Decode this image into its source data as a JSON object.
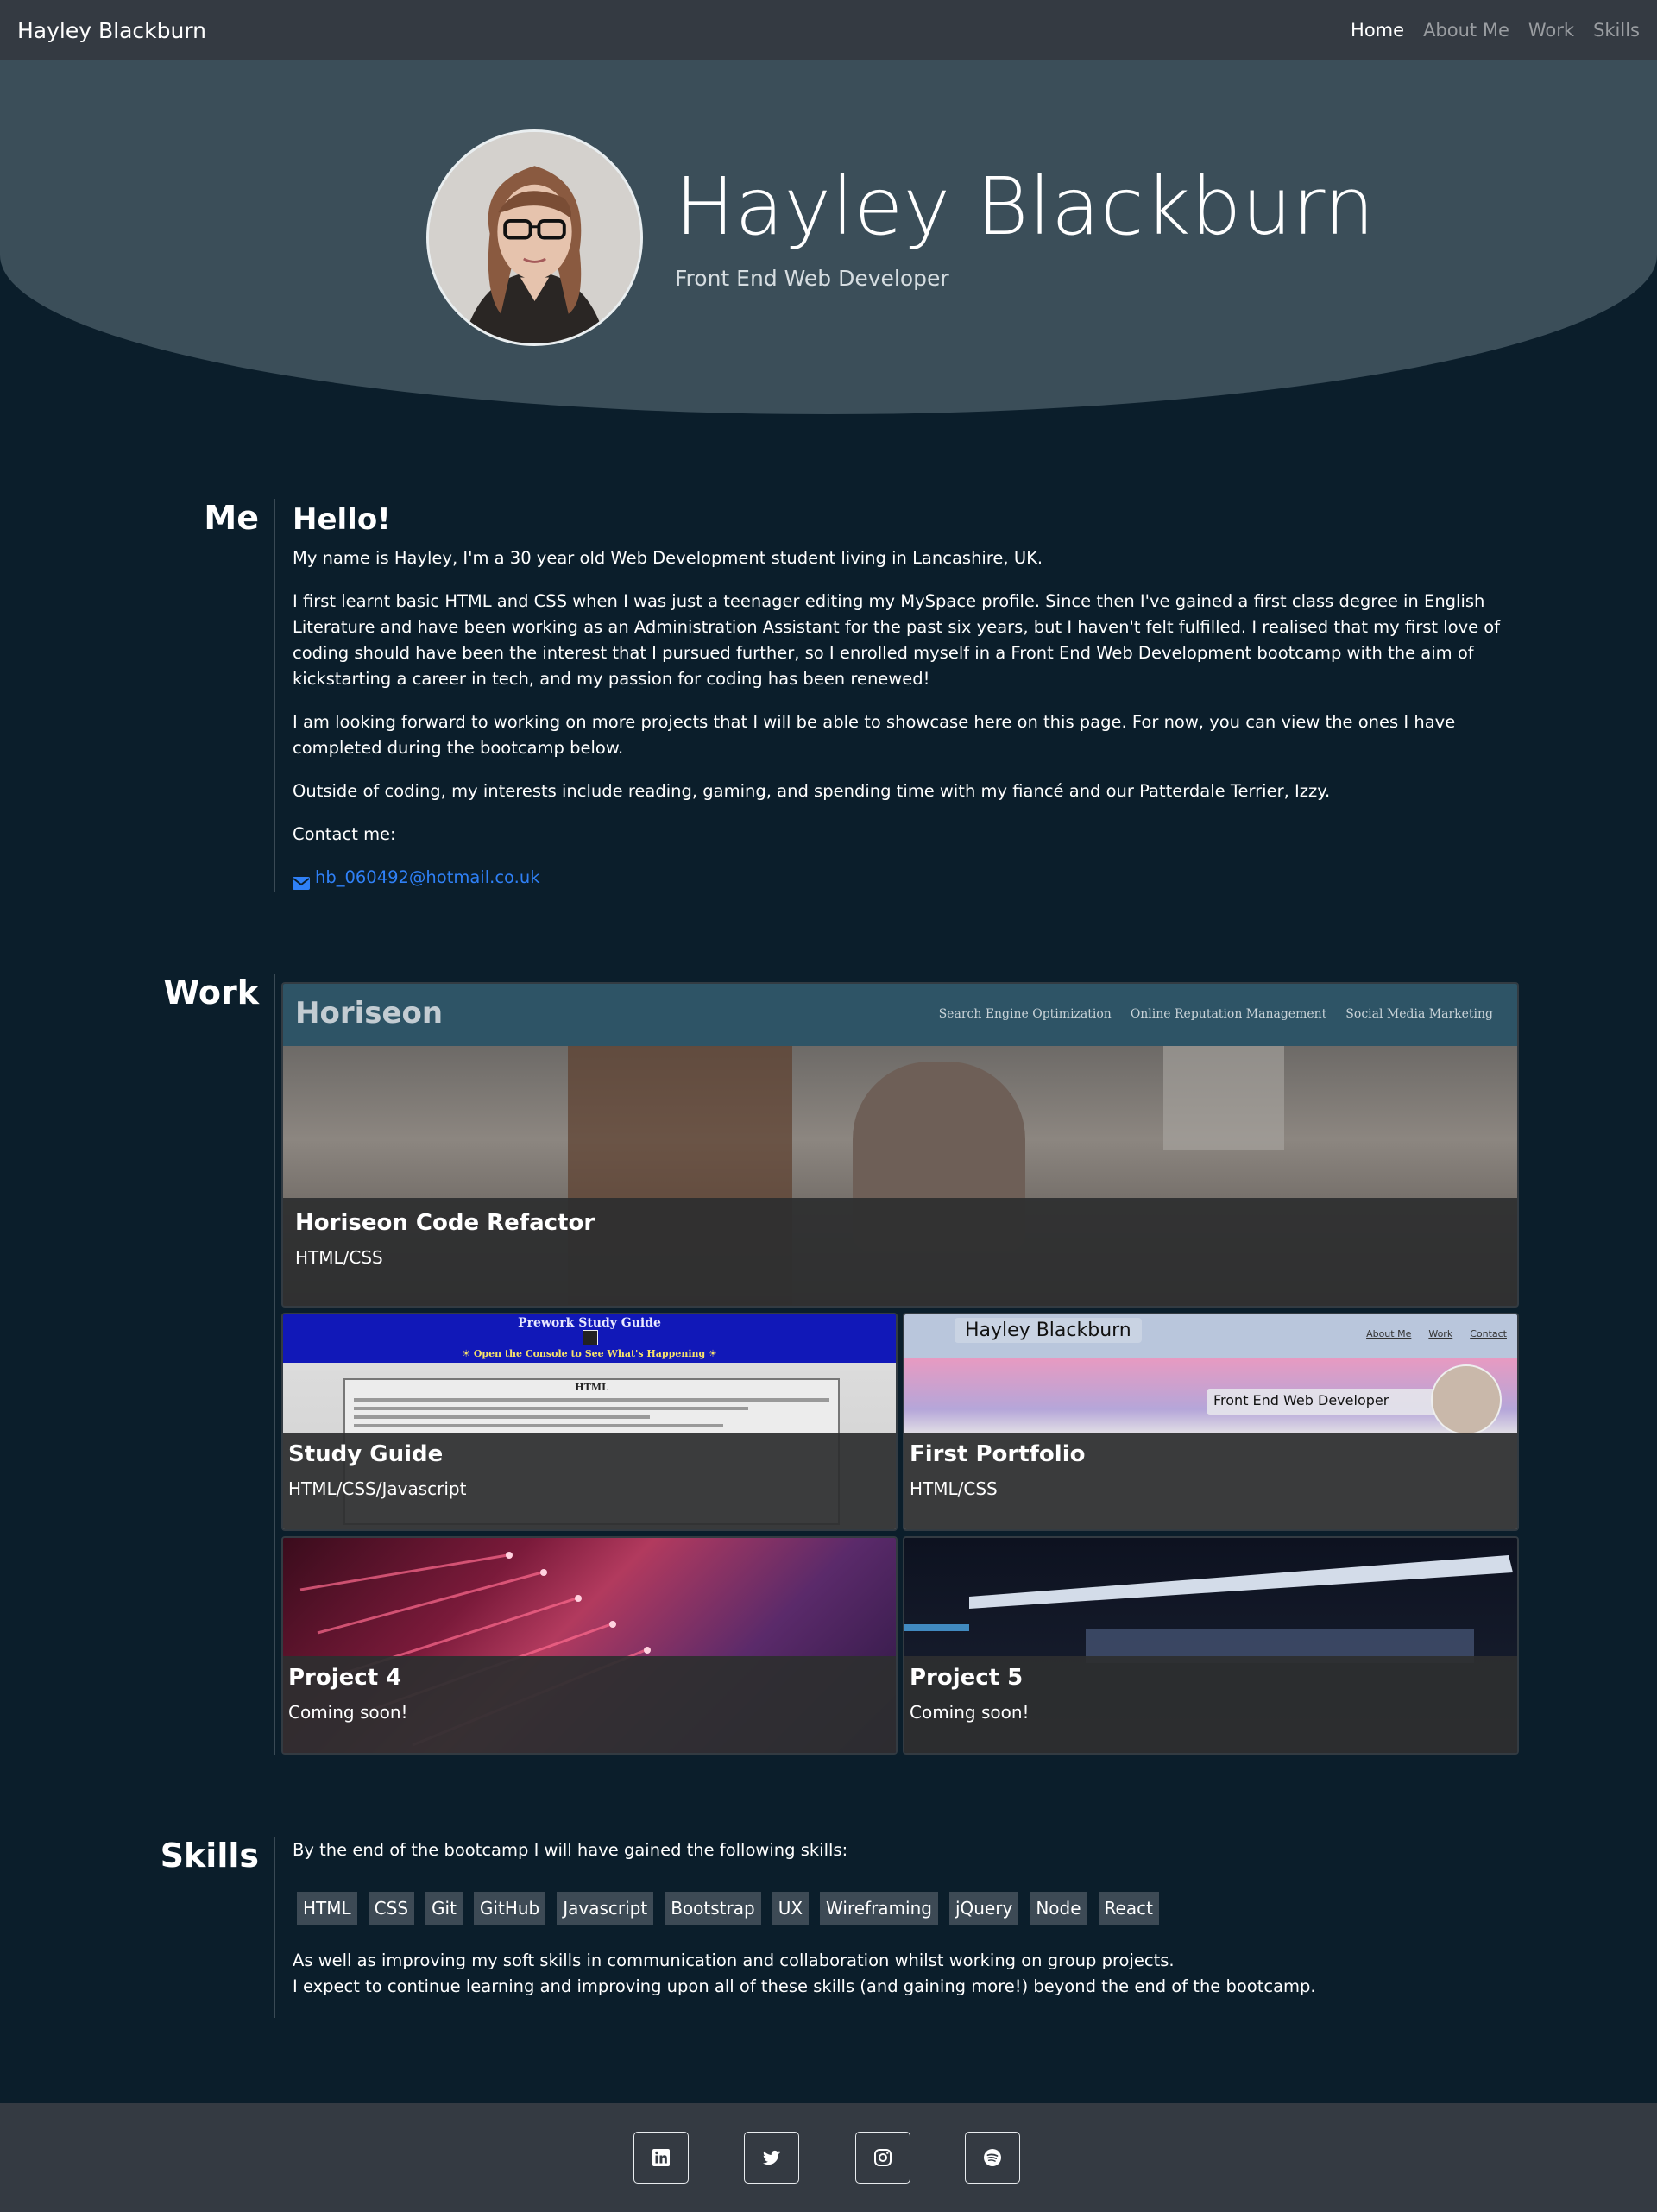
{
  "nav": {
    "brand": "Hayley Blackburn",
    "links": [
      "Home",
      "About Me",
      "Work",
      "Skills"
    ]
  },
  "hero": {
    "name": "Hayley Blackburn",
    "subtitle": "Front End Web Developer"
  },
  "me": {
    "section_title": "Me",
    "heading": "Hello!",
    "paragraphs": [
      "My name is Hayley, I'm a 30 year old Web Development student living in Lancashire, UK.",
      "I first learnt basic HTML and CSS when I was just a teenager editing my MySpace profile. Since then I've gained a first class degree in English Literature and have been working as an Administration Assistant for the past six years, but I haven't felt fulfilled. I realised that my first love of coding should have been the interest that I pursued further, so I enrolled myself in a Front End Web Development bootcamp with the aim of kickstarting a career in tech, and my passion for coding has been renewed!",
      "I am looking forward to working on more projects that I will be able to showcase here on this page. For now, you can view the ones I have completed during the bootcamp below.",
      "Outside of coding, my interests include reading, gaming, and spending time with my fiancé and our Patterdale Terrier, Izzy.",
      "Contact me:"
    ],
    "email": "hb_060492@hotmail.co.uk"
  },
  "work": {
    "section_title": "Work",
    "projects": [
      {
        "title": "Horiseon Code Refactor",
        "tech": "HTML/CSS"
      },
      {
        "title": "Study Guide",
        "tech": "HTML/CSS/Javascript"
      },
      {
        "title": "First Portfolio",
        "tech": "HTML/CSS"
      },
      {
        "title": "Project 4",
        "tech": "Coming soon!"
      },
      {
        "title": "Project 5",
        "tech": "Coming soon!"
      }
    ],
    "horiseon_preview": {
      "logo": "Horiseon",
      "menu": [
        "Search Engine Optimization",
        "Online Reputation Management",
        "Social Media Marketing"
      ]
    },
    "study_preview": {
      "title": "Prework Study Guide",
      "banner": "☀ Open the Console to See What's Happening ☀",
      "box_title": "HTML"
    },
    "portfolio_preview": {
      "name": "Hayley Blackburn",
      "links": [
        "About Me",
        "Work",
        "Contact"
      ],
      "subtitle": "Front End Web Developer"
    }
  },
  "skills": {
    "section_title": "Skills",
    "intro": "By the end of the bootcamp I will have gained the following skills:",
    "badges": [
      "HTML",
      "CSS",
      "Git",
      "GitHub",
      "Javascript",
      "Bootstrap",
      "UX",
      "Wireframing",
      "jQuery",
      "Node",
      "React"
    ],
    "outro_1": "As well as improving my soft skills in communication and collaboration whilst working on group projects.",
    "outro_2": "I expect to continue learning and improving upon all of these skills (and gaining more!) beyond the end of the bootcamp."
  },
  "footer": {
    "icons": [
      "linkedin-icon",
      "twitter-icon",
      "instagram-icon",
      "spotify-icon"
    ]
  },
  "colors": {
    "background": "#0b1e2b",
    "navbar": "#343a42",
    "hero": "#3b4e59",
    "link": "#2f80f6",
    "badge": "#3d4a55"
  }
}
